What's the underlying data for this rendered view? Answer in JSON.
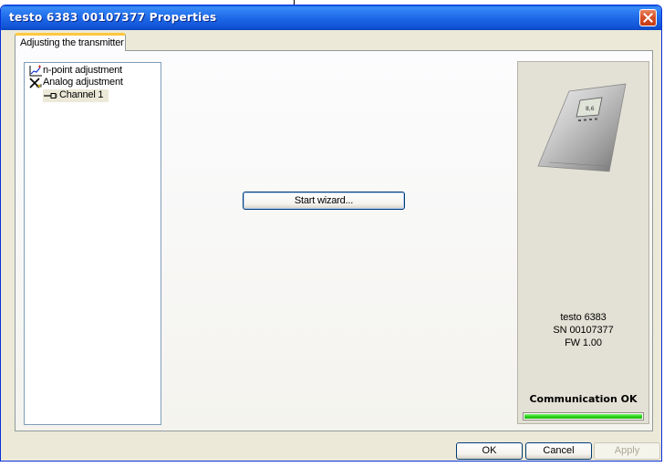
{
  "window": {
    "title": "testo 6383  00107377 Properties"
  },
  "tabs": [
    {
      "label": "Adjusting the transmitter",
      "selected": true
    }
  ],
  "tree": {
    "items": [
      {
        "label": "n-point adjustment",
        "icon": "n-point-graph-icon",
        "level": 0
      },
      {
        "label": "Analog adjustment",
        "icon": "analog-adjust-icon",
        "level": 0
      },
      {
        "label": "Channel 1",
        "icon": "channel-connector-icon",
        "level": 1,
        "selected": true
      }
    ]
  },
  "main": {
    "start_wizard_label": "Start wizard..."
  },
  "device": {
    "name": "testo 6383",
    "serial": "SN 00107377",
    "firmware": "FW  1.00",
    "status": "Communication OK",
    "status_progress": 1.0,
    "status_color": "#22cf11"
  },
  "buttons": {
    "ok": "OK",
    "cancel": "Cancel",
    "apply": "Apply"
  }
}
